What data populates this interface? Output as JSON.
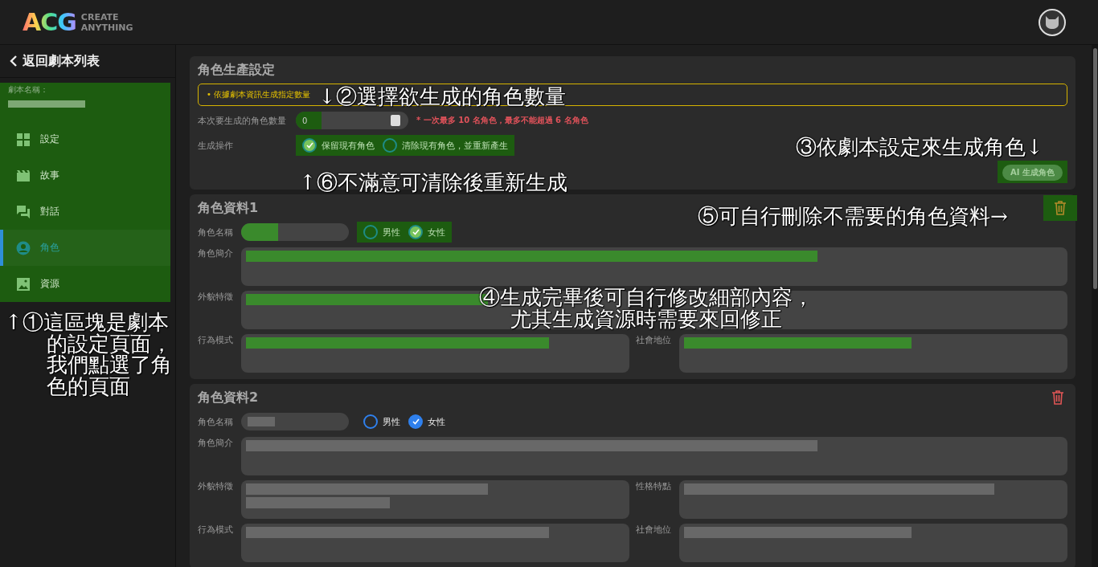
{
  "header": {
    "logo": {
      "mark": "ACG",
      "tagline": [
        "CREATE",
        "ANYTHING"
      ]
    }
  },
  "sidebar": {
    "back_link": "返回劇本列表",
    "highlighted": true,
    "script_name_label": "劇本名稱：",
    "items": [
      {
        "label": "設定",
        "selected": false
      },
      {
        "label": "故事",
        "selected": false
      },
      {
        "label": "對話",
        "selected": false
      },
      {
        "label": "角色",
        "selected": true
      },
      {
        "label": "資源",
        "selected": false
      }
    ]
  },
  "generation": {
    "title": "角色生產設定",
    "tip": "• 依據劇本資訊生成指定數量",
    "count_label": "本次要生成的角色數量",
    "count_value": "0",
    "count_highlighted": true,
    "count_note": "* 一次最多 10 名角色，最多不能超過 6 名角色",
    "action_label": "生成操作",
    "actions_highlighted": true,
    "actions": [
      {
        "label": "保留現有角色",
        "selected": true
      },
      {
        "label": "清除現有角色，並重新產生",
        "selected": false
      }
    ],
    "button": {
      "label": "AI 生成角色",
      "highlighted": true
    }
  },
  "characters": [
    {
      "title": "角色資料1",
      "highlighted": true,
      "name_label": "角色名稱",
      "genders": [
        {
          "label": "男性",
          "selected": false
        },
        {
          "label": "女性",
          "selected": true
        }
      ],
      "fields": [
        {
          "kind": "full",
          "label": "角色簡介"
        },
        {
          "kind": "half",
          "label": "外貌特徵"
        },
        {
          "kind": "half"
        },
        {
          "kind": "half",
          "label": "行為模式"
        },
        {
          "kind": "half",
          "label": "社會地位"
        }
      ]
    },
    {
      "title": "角色資料2",
      "highlighted": false,
      "name_label": "角色名稱",
      "genders": [
        {
          "label": "男性",
          "selected": false
        },
        {
          "label": "女性",
          "selected": true
        }
      ],
      "fields": [
        {
          "kind": "full",
          "label": "角色簡介"
        },
        {
          "kind": "half",
          "label": "外貌特徵"
        },
        {
          "kind": "half",
          "label": "性格特點"
        },
        {
          "kind": "half",
          "label": "行為模式"
        },
        {
          "kind": "half",
          "label": "社會地位"
        }
      ]
    }
  ],
  "annotations": [
    {
      "lines": [
        "↑①這區塊是劇本",
        "的設定頁面，",
        "我們點選了角",
        "色的頁面"
      ]
    },
    {
      "lines": [
        "↓②選擇欲生成的角色數量"
      ]
    },
    {
      "lines": [
        "③依劇本設定來生成角色↓"
      ]
    },
    {
      "lines": [
        "④生成完畢後可自行修改細部內容，",
        "尤其生成資源時需要來回修正"
      ]
    },
    {
      "lines": [
        "⑤可自行刪除不需要的角色資料→"
      ]
    },
    {
      "lines": [
        "↑⑥不滿意可清除後重新生成"
      ]
    }
  ]
}
